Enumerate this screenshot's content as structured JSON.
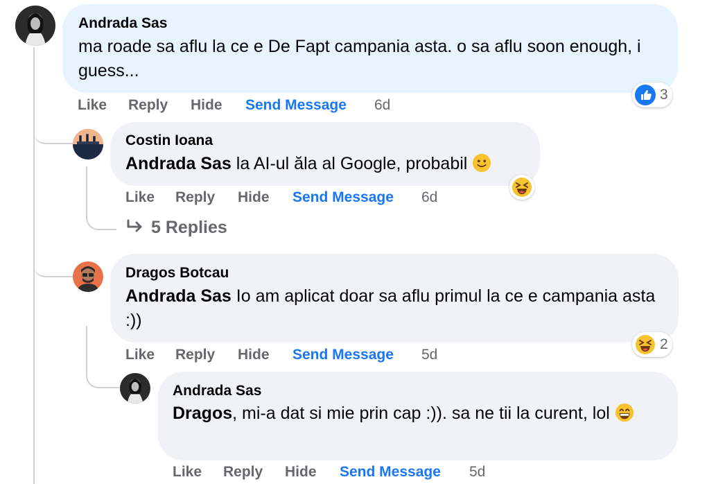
{
  "colors": {
    "bubble_blue": "#e7f3ff",
    "bubble_gray": "#f0f2f5",
    "link_blue": "#1877f2",
    "muted": "#65676b",
    "thread_line": "#ced0d4"
  },
  "comments": [
    {
      "author": "Andrada Sas",
      "text": "ma roade sa aflu la ce e De Fapt campania asta. o sa aflu soon enough, i guess...",
      "actions": {
        "like": "Like",
        "reply": "Reply",
        "hide": "Hide",
        "send": "Send Message",
        "time": "6d"
      },
      "reactions": {
        "icons": [
          "like-icon"
        ],
        "count": "3"
      }
    },
    {
      "author": "Costin Ioana",
      "mention": "Andrada Sas",
      "text": "la AI-ul ăla al Google, probabil",
      "emoji": "slightly-smiling-face",
      "actions": {
        "like": "Like",
        "reply": "Reply",
        "hide": "Hide",
        "send": "Send Message",
        "time": "6d"
      },
      "reactions": {
        "icons": [
          "haha-icon"
        ],
        "count": ""
      },
      "replies_link": "5 Replies"
    },
    {
      "author": "Dragos Botcau",
      "mention": "Andrada Sas",
      "text": "Io am aplicat doar sa aflu primul la ce e campania asta :))",
      "actions": {
        "like": "Like",
        "reply": "Reply",
        "hide": "Hide",
        "send": "Send Message",
        "time": "5d"
      },
      "reactions": {
        "icons": [
          "haha-icon"
        ],
        "count": "2"
      }
    },
    {
      "author": "Andrada Sas",
      "mention": "Dragos",
      "text": ", mi-a dat si mie prin cap :)). sa ne tii la curent, lol",
      "emoji": "grinning-face",
      "actions": {
        "like": "Like",
        "reply": "Reply",
        "hide": "Hide",
        "send": "Send Message",
        "time": "5d"
      }
    }
  ]
}
